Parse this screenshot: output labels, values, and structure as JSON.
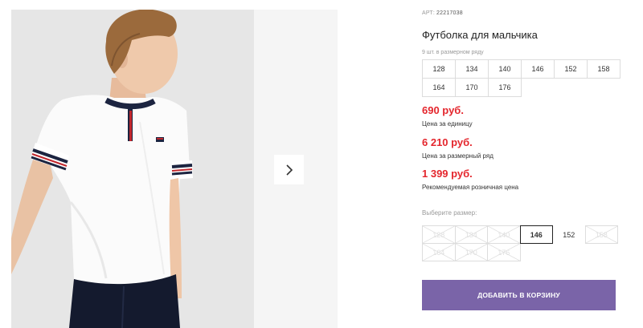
{
  "gallery": {
    "next_icon": "chevron-right-icon"
  },
  "product": {
    "art_label": "АРТ:",
    "art_number": "22217038",
    "title": "Футболка для мальчика",
    "row_info": "9 шт. в размерном ряду",
    "sizes": [
      "128",
      "134",
      "140",
      "146",
      "152",
      "158",
      "164",
      "170",
      "176"
    ]
  },
  "prices": {
    "unit_price": "690 руб.",
    "unit_label": "Цена за единицу",
    "row_price": "6 210 руб.",
    "row_label": "Цена за размерный ряд",
    "retail_price": "1 399 руб.",
    "retail_label": "Рекомендуемая розничная цена"
  },
  "size_picker": {
    "label": "Выберите размер:",
    "options": [
      {
        "size": "128",
        "state": "disabled"
      },
      {
        "size": "134",
        "state": "disabled"
      },
      {
        "size": "140",
        "state": "disabled"
      },
      {
        "size": "146",
        "state": "selected"
      },
      {
        "size": "152",
        "state": "available"
      },
      {
        "size": "158",
        "state": "disabled"
      },
      {
        "size": "164",
        "state": "disabled"
      },
      {
        "size": "170",
        "state": "disabled"
      },
      {
        "size": "176",
        "state": "disabled"
      }
    ]
  },
  "cart_button": {
    "label": "ДОБАВИТЬ В КОРЗИНУ"
  },
  "colors": {
    "accent": "#7a64a8",
    "price": "#e4262d"
  }
}
